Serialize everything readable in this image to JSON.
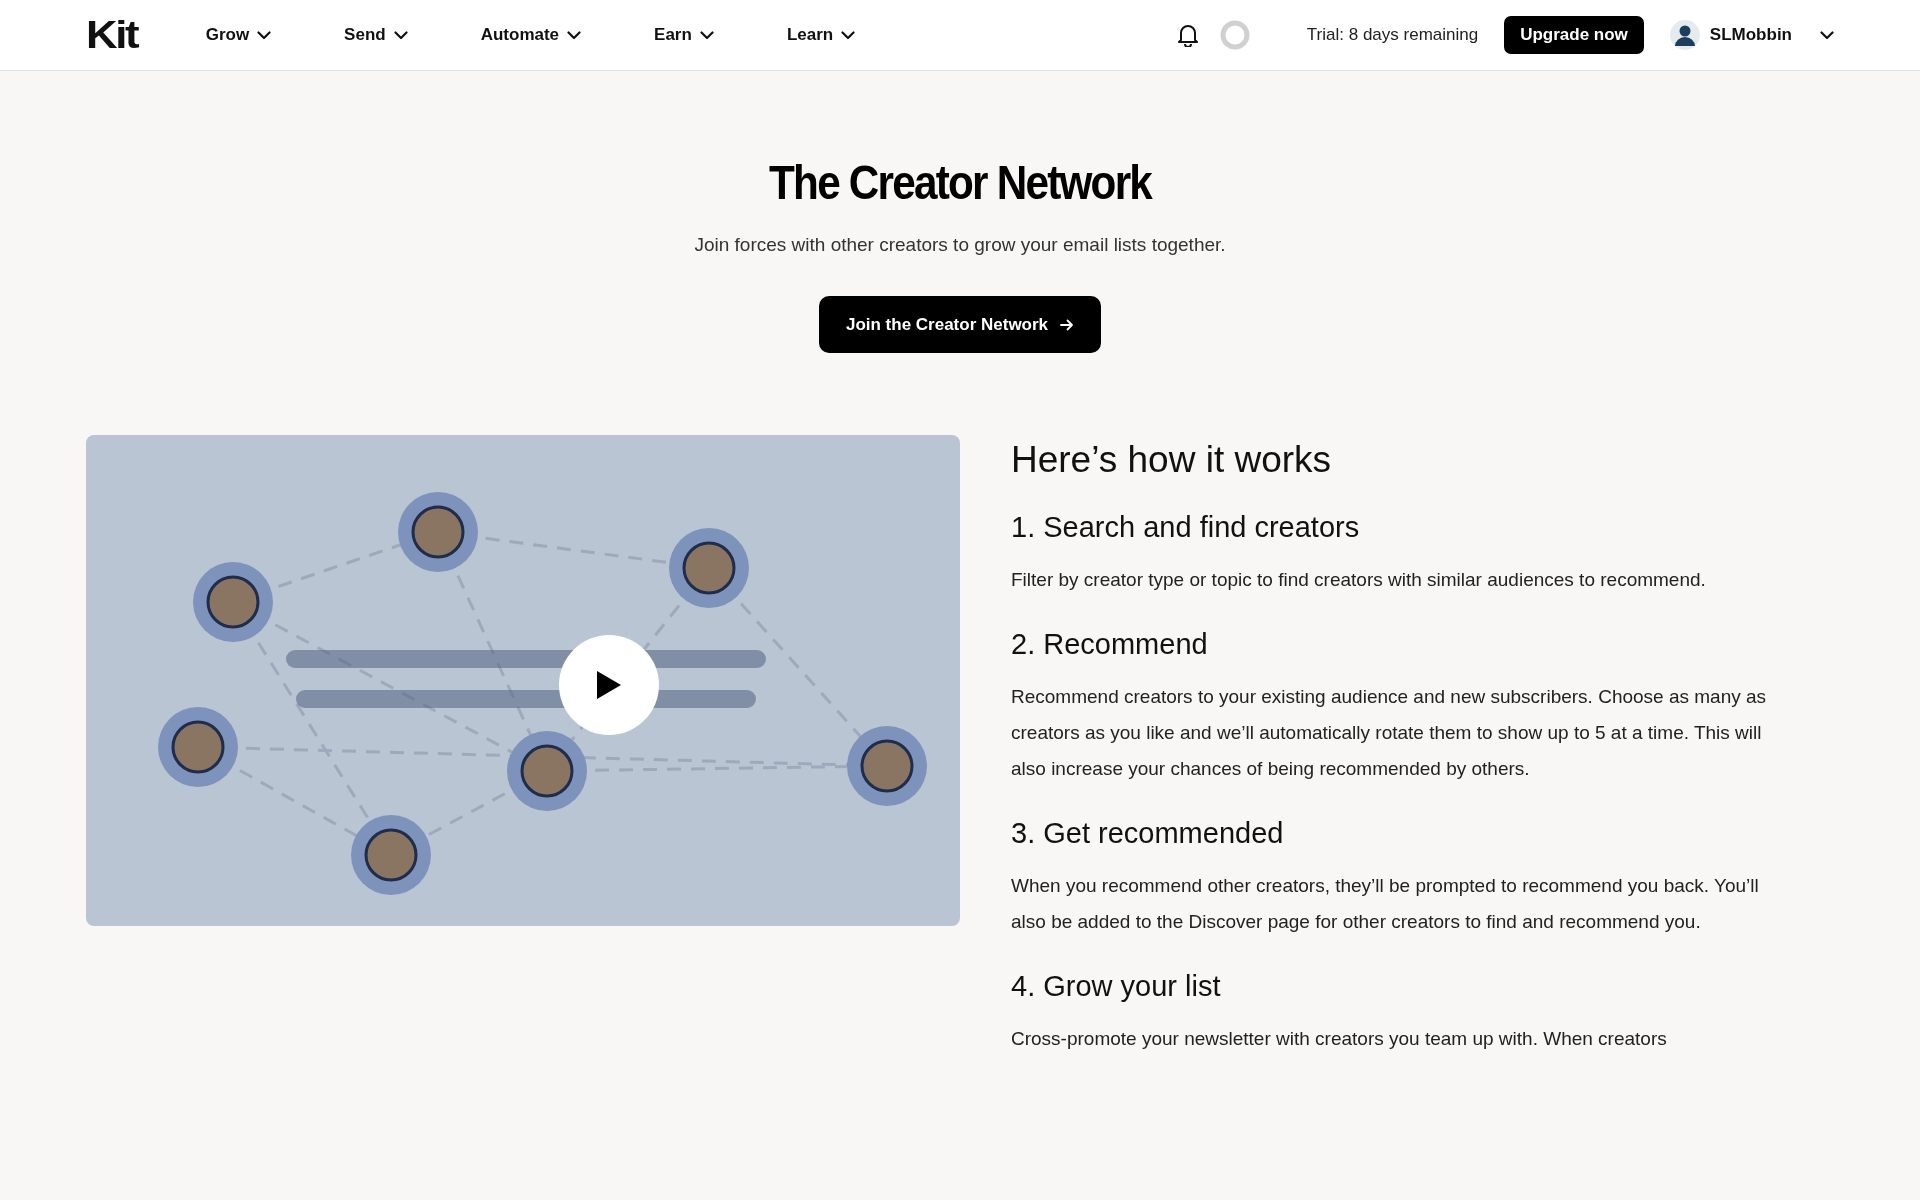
{
  "header": {
    "logo": "Kit",
    "nav": [
      {
        "label": "Grow"
      },
      {
        "label": "Send"
      },
      {
        "label": "Automate"
      },
      {
        "label": "Earn"
      },
      {
        "label": "Learn"
      }
    ],
    "trial": "Trial: 8 days remaining",
    "upgrade_button": "Upgrade now",
    "user": "SLMobbin"
  },
  "hero": {
    "title": "The Creator Network",
    "subtitle": "Join forces with other creators to grow your email lists together.",
    "cta": "Join the Creator Network"
  },
  "how_it_works": {
    "title": "Here’s how it works",
    "steps": [
      {
        "title": "1. Search and find creators",
        "text": "Filter by creator type or topic to find creators with similar audiences to recommend."
      },
      {
        "title": "2. Recommend",
        "text": "Recommend creators to your existing audience and new subscribers. Choose as many as creators as you like and we’ll automatically rotate them to show up to 5 at a time. This will also increase your chances of being recommended by others."
      },
      {
        "title": "3. Get recommended",
        "text": "When you recommend other creators, they’ll be prompted to recommend you back. You’ll also be added to the Discover page for other creators to find and recommend you."
      },
      {
        "title": "4. Grow your list",
        "text": "Cross-promote your newsletter with creators you team up with. When creators"
      }
    ]
  }
}
